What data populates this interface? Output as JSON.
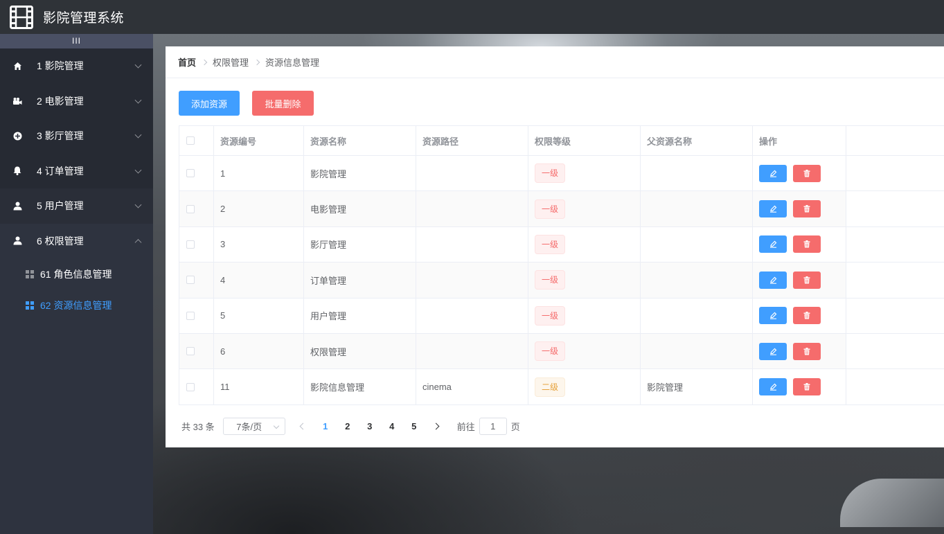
{
  "app": {
    "title": "影院管理系统"
  },
  "sidebar": {
    "collapse_label": "III",
    "items": [
      {
        "label": "1 影院管理",
        "icon": "home-icon"
      },
      {
        "label": "2 电影管理",
        "icon": "camera-icon"
      },
      {
        "label": "3 影厅管理",
        "icon": "circle-plus-icon"
      },
      {
        "label": "4 订单管理",
        "icon": "bell-icon"
      },
      {
        "label": "5 用户管理",
        "icon": "user-icon"
      },
      {
        "label": "6 权限管理",
        "icon": "user-icon"
      }
    ],
    "sub_items": [
      {
        "label": "61 角色信息管理",
        "active": false
      },
      {
        "label": "62 资源信息管理",
        "active": true
      }
    ]
  },
  "breadcrumb": {
    "home": "首页",
    "level1": "权限管理",
    "level2": "资源信息管理"
  },
  "toolbar": {
    "add_label": "添加资源",
    "batch_delete_label": "批量删除"
  },
  "table": {
    "headers": [
      "资源编号",
      "资源名称",
      "资源路径",
      "权限等级",
      "父资源名称",
      "操作"
    ],
    "rows": [
      {
        "id": "1",
        "name": "影院管理",
        "path": "",
        "level": "一级",
        "parent": ""
      },
      {
        "id": "2",
        "name": "电影管理",
        "path": "",
        "level": "一级",
        "parent": ""
      },
      {
        "id": "3",
        "name": "影厅管理",
        "path": "",
        "level": "一级",
        "parent": ""
      },
      {
        "id": "4",
        "name": "订单管理",
        "path": "",
        "level": "一级",
        "parent": ""
      },
      {
        "id": "5",
        "name": "用户管理",
        "path": "",
        "level": "一级",
        "parent": ""
      },
      {
        "id": "6",
        "name": "权限管理",
        "path": "",
        "level": "一级",
        "parent": ""
      },
      {
        "id": "11",
        "name": "影院信息管理",
        "path": "cinema",
        "level": "二级",
        "parent": "影院管理"
      }
    ]
  },
  "pagination": {
    "total_text": "共 33 条",
    "page_size": "7条/页",
    "pages": [
      "1",
      "2",
      "3",
      "4",
      "5"
    ],
    "current": "1",
    "goto_prefix": "前往",
    "goto_value": "1",
    "goto_suffix": "页"
  },
  "colors": {
    "primary": "#409eff",
    "danger": "#f56c6c",
    "sidebar": "#2e333f",
    "header": "#2f3338"
  }
}
